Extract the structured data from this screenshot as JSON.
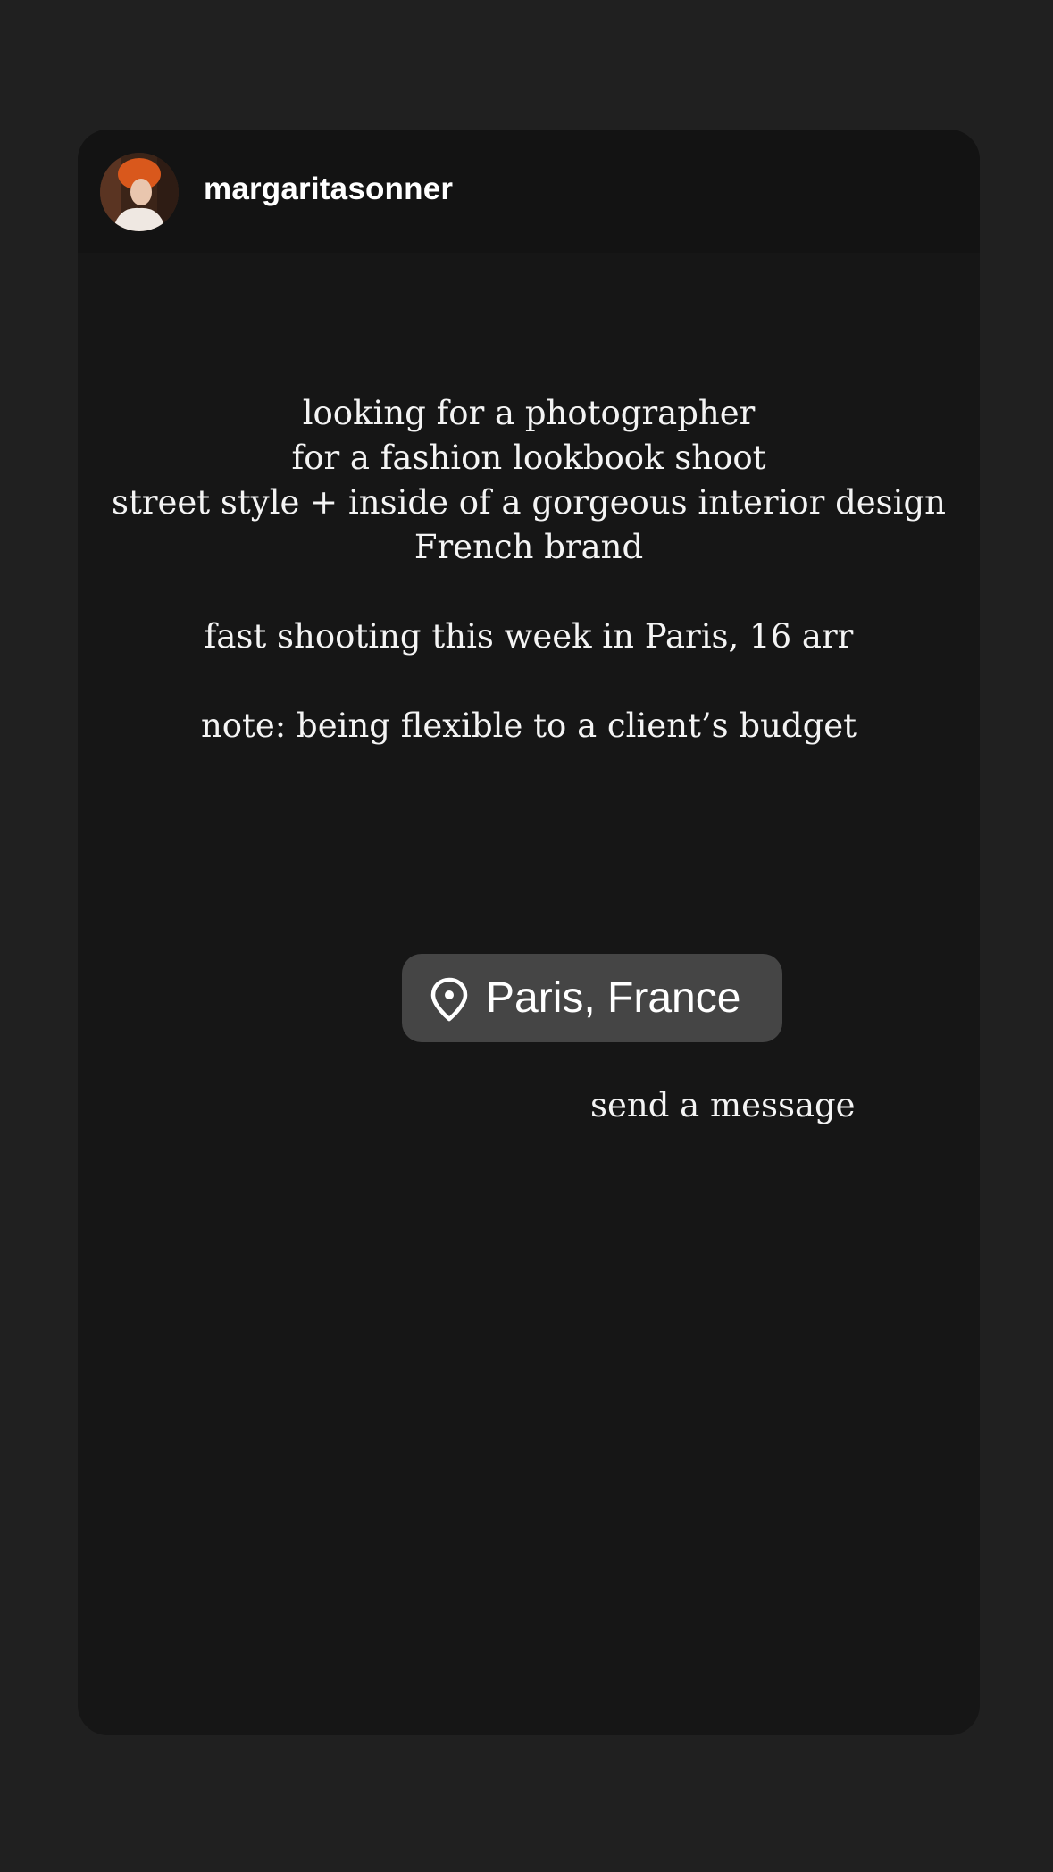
{
  "story": {
    "username": "margaritasonner",
    "avatar_icon": "profile-photo-avatar",
    "text_lines": [
      "looking for a photographer",
      "for a fashion lookbook shoot",
      "street style + inside of a gorgeous interior design",
      "French brand",
      "fast shooting this week in Paris, 16 arr",
      "note: being flexible to a client’s budget"
    ],
    "location_sticker": {
      "icon": "location-pin-icon",
      "label": "Paris, France"
    },
    "send_message_label": "send a message"
  },
  "colors": {
    "page_background": "#202020",
    "card_background": "#161616",
    "header_background": "#131313",
    "sticker_background": "#454545",
    "text": "#f4f4f4",
    "avatar_accent": "#d9581c"
  }
}
